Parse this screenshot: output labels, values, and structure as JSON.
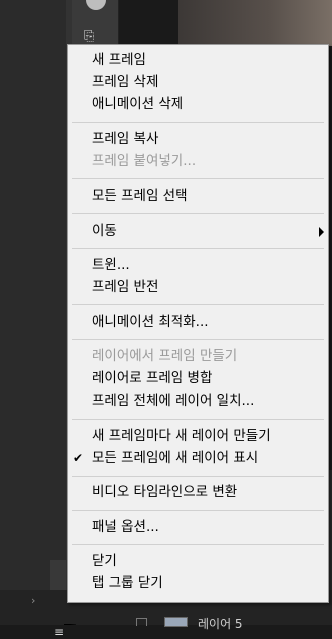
{
  "menu": {
    "items": [
      {
        "id": "new-frame",
        "label": "새 프레임",
        "enabled": true
      },
      {
        "id": "delete-frame",
        "label": "프레임 삭제",
        "enabled": true
      },
      {
        "id": "delete-animation",
        "label": "애니메이션 삭제",
        "enabled": true
      },
      {
        "id": "copy-frame",
        "label": "프레임 복사",
        "enabled": true
      },
      {
        "id": "paste-frames",
        "label": "프레임 붙여넣기...",
        "enabled": false
      },
      {
        "id": "select-all-frames",
        "label": "모든 프레임 선택",
        "enabled": true
      },
      {
        "id": "go-to",
        "label": "이동",
        "enabled": true,
        "submenu": true
      },
      {
        "id": "tween",
        "label": "트윈...",
        "enabled": true
      },
      {
        "id": "reverse-frames",
        "label": "프레임 반전",
        "enabled": true
      },
      {
        "id": "optimize-animation",
        "label": "애니메이션 최적화...",
        "enabled": true
      },
      {
        "id": "make-frames-from-layers",
        "label": "레이어에서 프레임 만들기",
        "enabled": false
      },
      {
        "id": "flatten-frames-into-layers",
        "label": "레이어로 프레임 병합",
        "enabled": true
      },
      {
        "id": "match-layer-across-frames",
        "label": "프레임 전체에 레이어 일치...",
        "enabled": true
      },
      {
        "id": "create-new-layer-each-frame",
        "label": "새 프레임마다 새 레이어 만들기",
        "enabled": true
      },
      {
        "id": "new-layers-visible-all-frames",
        "label": "모든 프레임에 새 레이어 표시",
        "enabled": true,
        "checked": true
      },
      {
        "id": "convert-to-video-timeline",
        "label": "비디오 타임라인으로 변환",
        "enabled": true
      },
      {
        "id": "panel-options",
        "label": "패널 옵션...",
        "enabled": true
      },
      {
        "id": "close",
        "label": "닫기",
        "enabled": true
      },
      {
        "id": "close-tab-group",
        "label": "탭 그룹 닫기",
        "enabled": true
      }
    ]
  },
  "background": {
    "layer_name": "레이어 5"
  },
  "icons": {
    "check": "checkmark-icon",
    "submenu": "submenu-arrow-icon",
    "cursor": "mouse-pointer-icon",
    "panel_menu": "panel-menu-icon"
  },
  "colors": {
    "menu_bg": "#f0f0f0",
    "disabled_text": "#9a9a9a",
    "app_bg": "#2b2b2b"
  }
}
